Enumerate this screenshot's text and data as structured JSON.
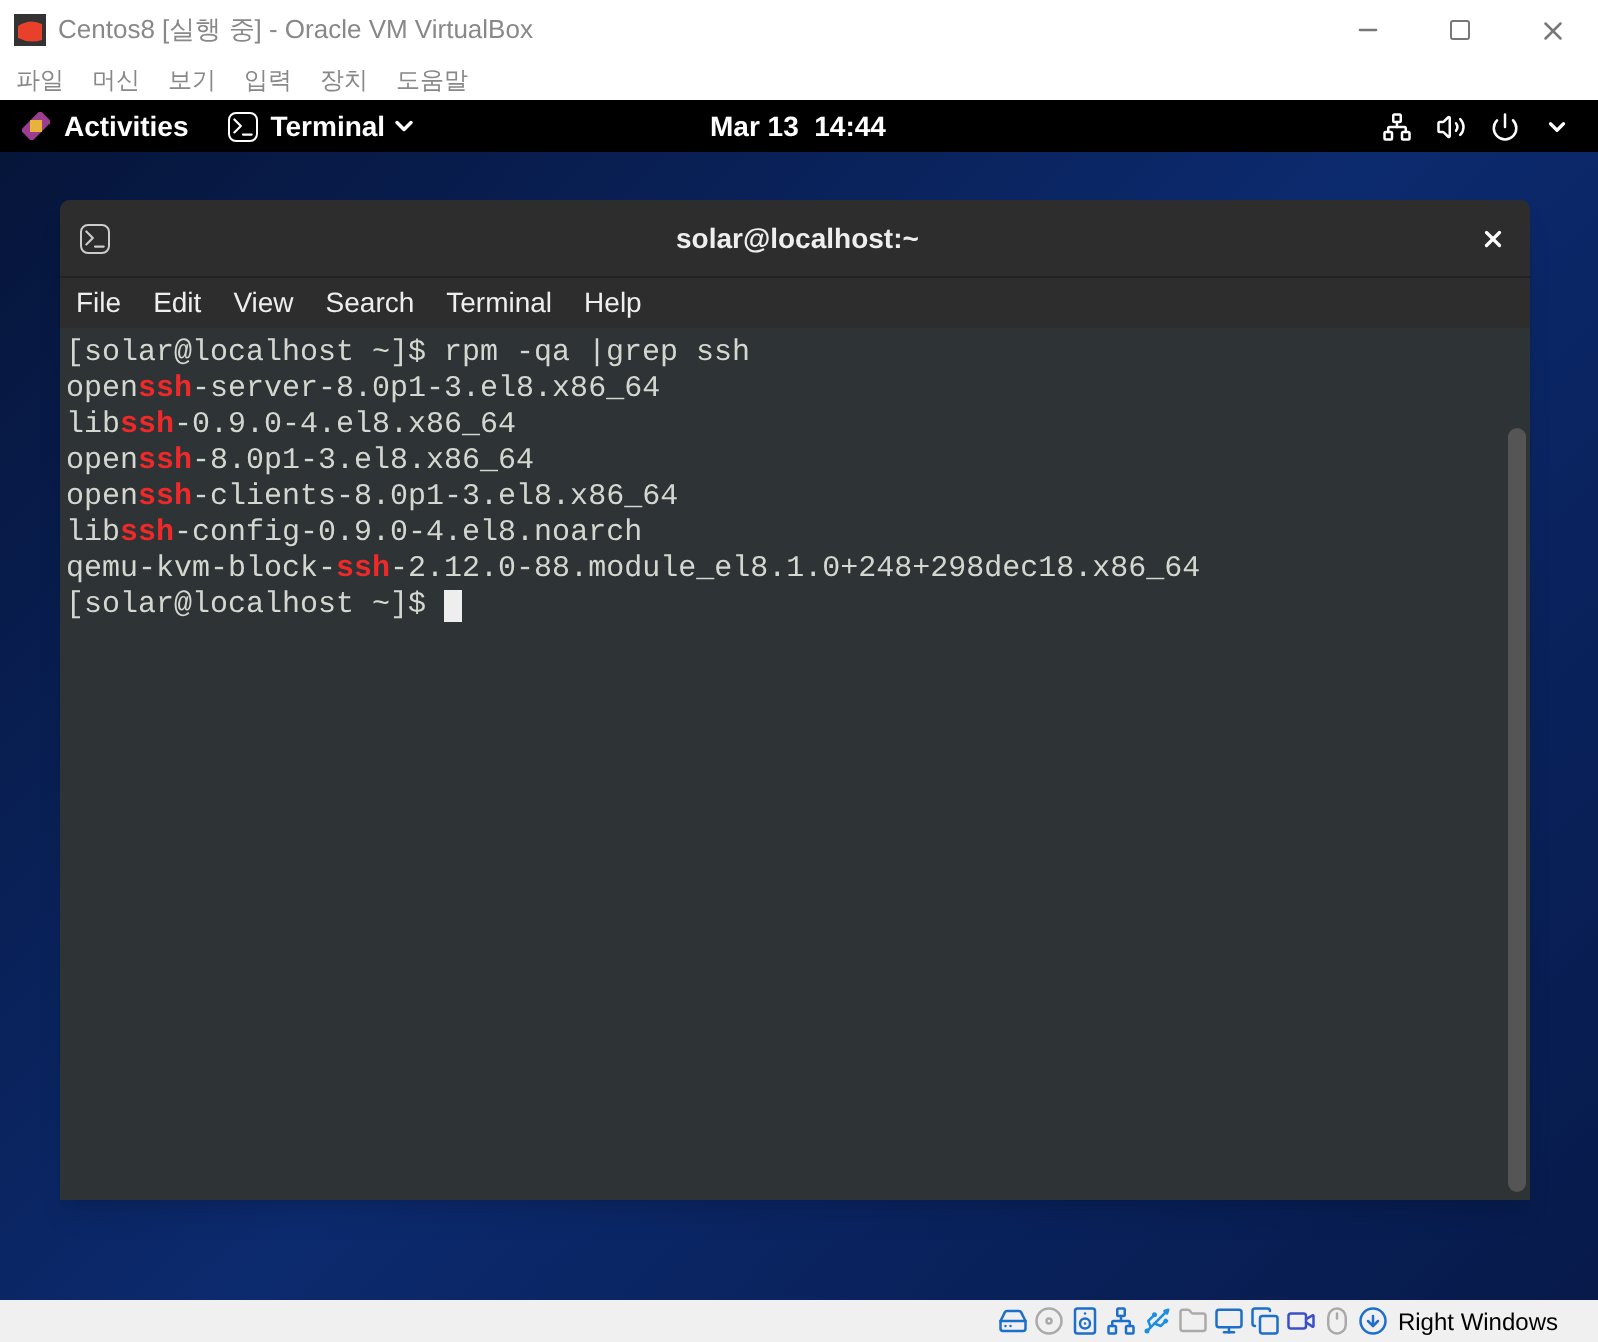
{
  "window": {
    "title": "Centos8 [실행 중] - Oracle VM VirtualBox"
  },
  "menu": [
    "파일",
    "머신",
    "보기",
    "입력",
    "장치",
    "도움말"
  ],
  "top_bar": {
    "activities": "Activities",
    "app": "Terminal",
    "clock": "Mar 13  14:44"
  },
  "terminal": {
    "title": "solar@localhost:~",
    "menu": [
      "File",
      "Edit",
      "View",
      "Search",
      "Terminal",
      "Help"
    ],
    "lines": [
      [
        {
          "text": "[solar@localhost ~]$ rpm -qa |grep ssh",
          "match": false
        }
      ],
      [
        {
          "text": "open",
          "match": false
        },
        {
          "text": "ssh",
          "match": true
        },
        {
          "text": "-server-8.0p1-3.el8.x86_64",
          "match": false
        }
      ],
      [
        {
          "text": "lib",
          "match": false
        },
        {
          "text": "ssh",
          "match": true
        },
        {
          "text": "-0.9.0-4.el8.x86_64",
          "match": false
        }
      ],
      [
        {
          "text": "open",
          "match": false
        },
        {
          "text": "ssh",
          "match": true
        },
        {
          "text": "-8.0p1-3.el8.x86_64",
          "match": false
        }
      ],
      [
        {
          "text": "open",
          "match": false
        },
        {
          "text": "ssh",
          "match": true
        },
        {
          "text": "-clients-8.0p1-3.el8.x86_64",
          "match": false
        }
      ],
      [
        {
          "text": "lib",
          "match": false
        },
        {
          "text": "ssh",
          "match": true
        },
        {
          "text": "-config-0.9.0-4.el8.noarch",
          "match": false
        }
      ],
      [
        {
          "text": "qemu-kvm-block-",
          "match": false
        },
        {
          "text": "ssh",
          "match": true
        },
        {
          "text": "-2.12.0-88.module_el8.1.0+248+298dec18.x86_64",
          "match": false
        }
      ],
      [
        {
          "text": "[solar@localhost ~]$ ",
          "match": false
        }
      ]
    ]
  },
  "status_bar": {
    "host_key": "Right Windows"
  }
}
